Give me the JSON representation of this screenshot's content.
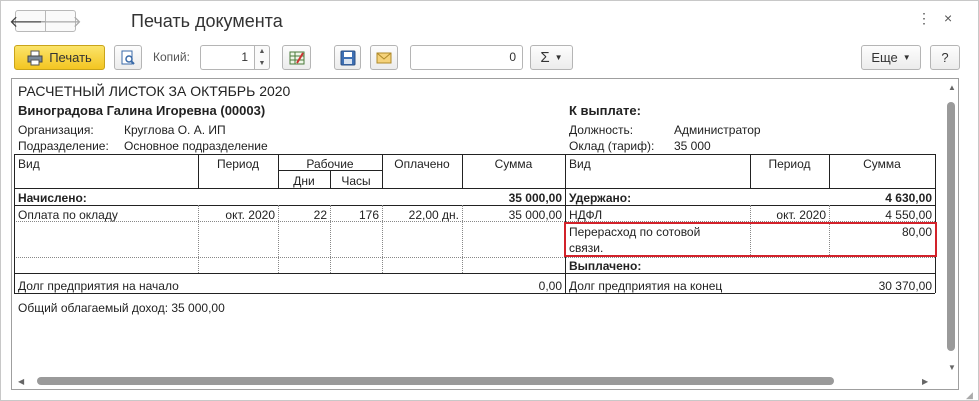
{
  "window": {
    "title": "Печать документа",
    "back_arrow": "🡐",
    "forward_arrow": "🡒",
    "menu_glyph": "⋮",
    "close_glyph": "×"
  },
  "toolbar": {
    "print_label": "Печать",
    "copies_label": "Копий:",
    "copies_value": "1",
    "sum_value": "0",
    "sigma_label": "Σ",
    "more_label": "Еще",
    "help_label": "?"
  },
  "payslip": {
    "heading": "РАСЧЕТНЫЙ ЛИСТОК ЗА ОКТЯБРЬ 2020",
    "employee": "Виноградова Галина Игоревна (00003)",
    "payout_label": "К выплате:",
    "org_label": "Организация:",
    "org_value": "Круглова О. А. ИП",
    "dept_label": "Подразделение:",
    "dept_value": "Основное подразделение",
    "position_label": "Должность:",
    "position_value": "Администратор",
    "salary_label": "Оклад (тариф):",
    "salary_value": "35 000",
    "columns": {
      "vid": "Вид",
      "period": "Период",
      "worked": "Рабочие",
      "days": "Дни",
      "hours": "Часы",
      "paid": "Оплачено",
      "sum": "Сумма"
    },
    "accrued_label": "Начислено:",
    "accrued_total": "35 000,00",
    "withheld_label": "Удержано:",
    "withheld_total": "4 630,00",
    "accruals": [
      {
        "name": "Оплата по окладу",
        "period": "окт. 2020",
        "days": "22",
        "hours": "176",
        "paid": "22,00 дн.",
        "sum": "35 000,00"
      }
    ],
    "deductions": [
      {
        "name": "НДФЛ",
        "period": "окт. 2020",
        "sum": "4 550,00"
      },
      {
        "name_line1": "Перерасход по сотовой",
        "name_line2": "связи.",
        "period": "",
        "sum": "80,00"
      }
    ],
    "paid_out_label": "Выплачено:",
    "debt_start_label": "Долг предприятия на начало",
    "debt_start_value": "0,00",
    "debt_end_label": "Долг предприятия на конец",
    "debt_end_value": "30 370,00",
    "taxable_income": "Общий облагаемый доход: 35 000,00"
  },
  "colors": {
    "highlight": "#d2222a",
    "print_button": "#f3c521"
  }
}
